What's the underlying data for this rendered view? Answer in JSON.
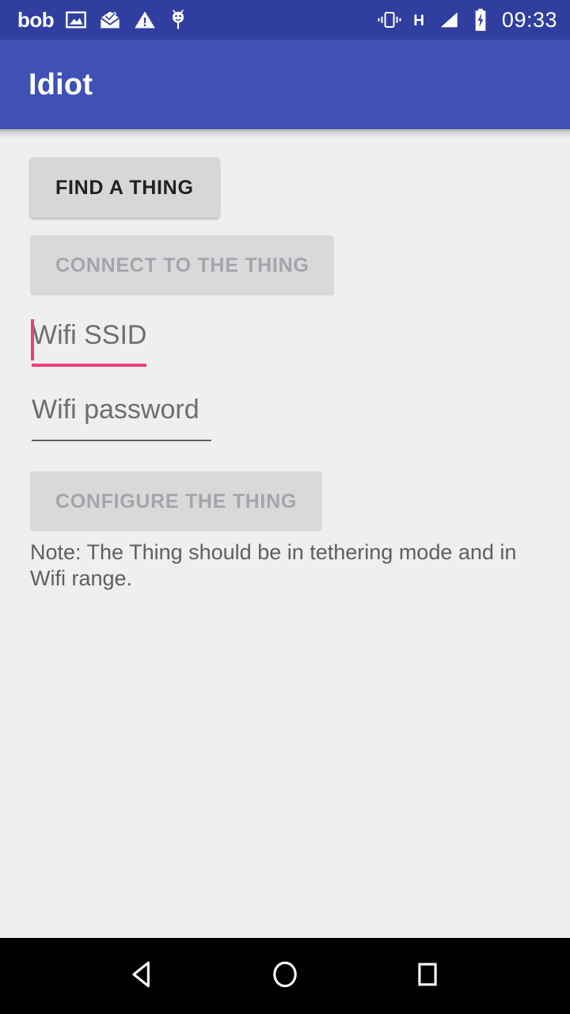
{
  "status_bar": {
    "carrier": "bob",
    "time": "09:33",
    "network_type": "H",
    "background_color": "#303F9F",
    "icons": [
      "photo-icon",
      "mail-read-icon",
      "warning-icon",
      "android-debug-icon",
      "vibrate-icon",
      "signal-icon",
      "battery-charging-icon"
    ]
  },
  "action_bar": {
    "title": "Idiot",
    "background_color": "#3F51B5"
  },
  "content": {
    "background_color": "#EFEFF1",
    "buttons": [
      {
        "id": "find",
        "label": "FIND A THING",
        "enabled": true
      },
      {
        "id": "connect",
        "label": "CONNECT TO THE THING",
        "enabled": false
      },
      {
        "id": "configure",
        "label": "CONFIGURE THE THING",
        "enabled": false
      }
    ],
    "fields": [
      {
        "id": "ssid",
        "placeholder": "Wifi SSID",
        "value": "",
        "focused": true,
        "accent_color": "#EC407A"
      },
      {
        "id": "password",
        "placeholder": "Wifi password",
        "value": "",
        "focused": false,
        "accent_color": "#616161"
      }
    ],
    "note": "Note: The Thing should be in tethering mode and in Wifi range."
  },
  "nav_bar": {
    "background_color": "#000000",
    "buttons": [
      {
        "id": "back",
        "icon": "back-triangle-icon"
      },
      {
        "id": "home",
        "icon": "home-circle-icon"
      },
      {
        "id": "recents",
        "icon": "recents-square-icon"
      }
    ]
  }
}
